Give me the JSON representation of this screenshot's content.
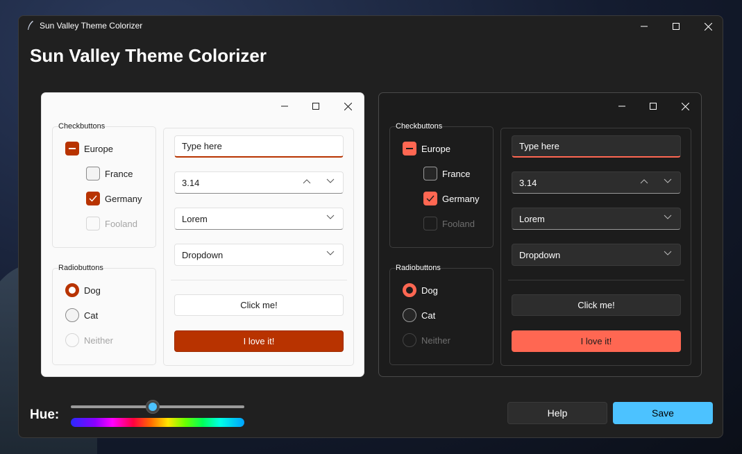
{
  "window": {
    "title": "Sun Valley Theme Colorizer"
  },
  "heading": "Sun Valley Theme Colorizer",
  "colors": {
    "light_accent": "#b83300",
    "dark_accent": "#ff6752",
    "save_accent": "#4cc2ff"
  },
  "preview": {
    "checkbuttons_title": "Checkbuttons",
    "checkbuttons": [
      {
        "label": "Europe",
        "state": "indeterminate"
      },
      {
        "label": "France",
        "state": "unchecked"
      },
      {
        "label": "Germany",
        "state": "checked"
      },
      {
        "label": "Fooland",
        "state": "disabled"
      }
    ],
    "radiobuttons_title": "Radiobuttons",
    "radiobuttons": [
      {
        "label": "Dog",
        "state": "selected"
      },
      {
        "label": "Cat",
        "state": "unselected"
      },
      {
        "label": "Neither",
        "state": "disabled"
      }
    ],
    "entry_value": "Type here",
    "spinbox_value": "3.14",
    "combobox_value": "Lorem",
    "dropdown_value": "Dropdown",
    "button_label": "Click me!",
    "accent_button_label": "I love it!"
  },
  "hue": {
    "label": "Hue:",
    "value_fraction": 0.47
  },
  "buttons": {
    "help": "Help",
    "save": "Save"
  }
}
